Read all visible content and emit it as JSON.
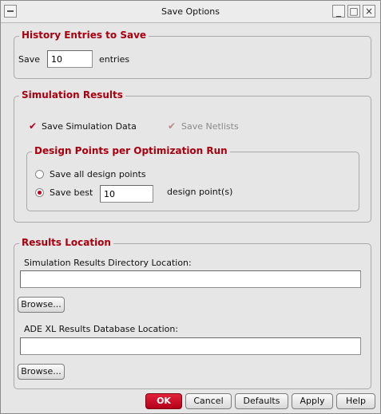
{
  "window": {
    "title": "Save Options"
  },
  "history": {
    "legend": "History Entries to Save",
    "save_label": "Save",
    "value": "10",
    "unit": "entries"
  },
  "simulation": {
    "legend": "Simulation Results",
    "save_data_label": "Save Simulation Data",
    "save_data_checked": true,
    "save_netlists_label": "Save Netlists",
    "save_netlists_checked": true,
    "design_points": {
      "legend": "Design Points per Optimization Run",
      "all_label": "Save all design points",
      "best_label": "Save best",
      "best_value": "10",
      "best_unit": "design point(s)",
      "selected": "best"
    }
  },
  "location": {
    "legend": "Results Location",
    "sim_dir_label": "Simulation Results Directory Location:",
    "sim_dir_value": "",
    "browse1_label": "Browse...",
    "db_label": "ADE XL Results Database Location:",
    "db_value": "",
    "browse2_label": "Browse..."
  },
  "buttons": {
    "ok": "OK",
    "cancel": "Cancel",
    "defaults": "Defaults",
    "apply": "Apply",
    "help": "Help"
  },
  "colors": {
    "accent": "#a8000f",
    "ok_button": "#c8102e"
  }
}
